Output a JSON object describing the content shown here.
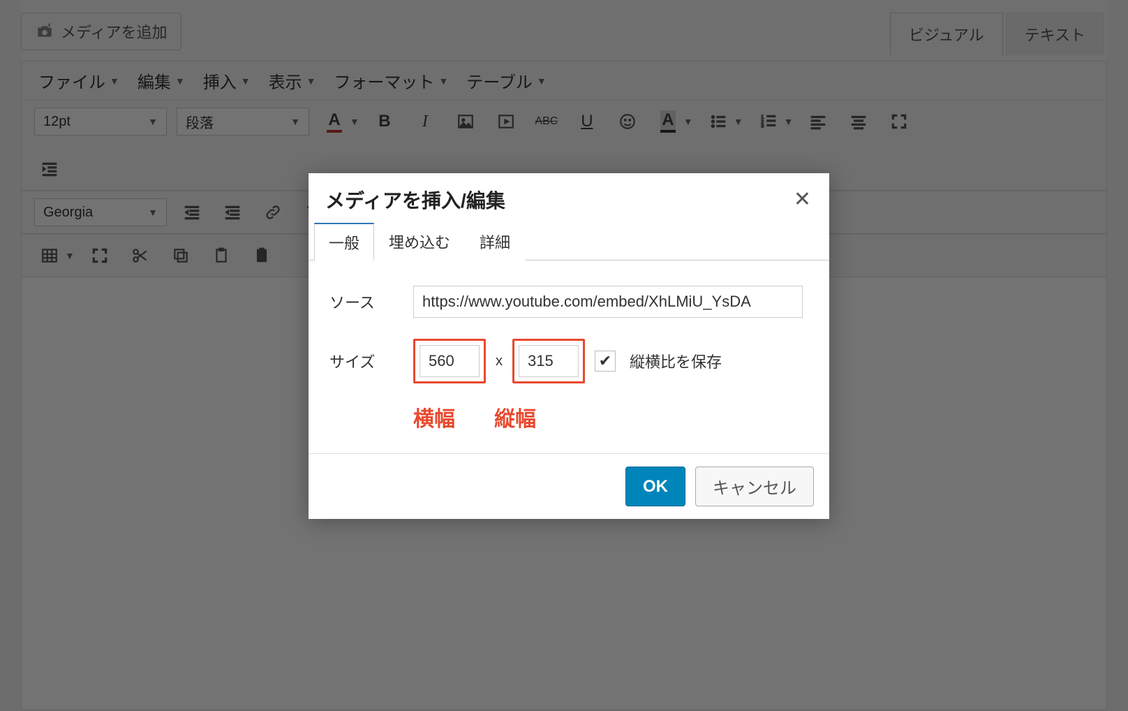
{
  "topbar": {
    "add_media": "メディアを追加",
    "mode_visual": "ビジュアル",
    "mode_text": "テキスト"
  },
  "menu": {
    "file": "ファイル",
    "edit": "編集",
    "insert": "挿入",
    "view": "表示",
    "format": "フォーマット",
    "table": "テーブル"
  },
  "toolbar": {
    "font_size": "12pt",
    "block_format": "段落",
    "font_family": "Georgia"
  },
  "dialog": {
    "title": "メディアを挿入/編集",
    "tabs": {
      "general": "一般",
      "embed": "埋め込む",
      "advanced": "詳細"
    },
    "labels": {
      "source": "ソース",
      "size": "サイズ",
      "aspect": "縦横比を保存"
    },
    "source_value": "https://www.youtube.com/embed/XhLMiU_YsDA",
    "width": "560",
    "height": "315",
    "size_separator": "x",
    "aspect_checked": true,
    "annotations": {
      "width": "横幅",
      "height": "縦幅"
    },
    "buttons": {
      "ok": "OK",
      "cancel": "キャンセル"
    }
  }
}
